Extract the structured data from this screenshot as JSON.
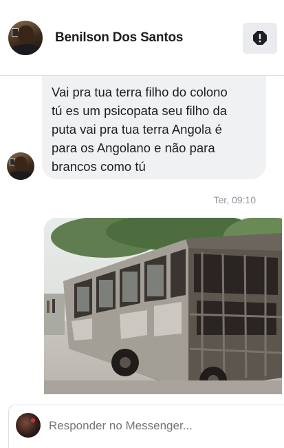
{
  "header": {
    "contact_name": "Benilson Dos Santos",
    "info_icon": "exclamation-octagon-icon"
  },
  "messages": [
    {
      "sender": "Benilson Dos Santos",
      "text": "Vai pra tua terra filho do colono\ntú es um psicopata seu filho da\nputa vai pra tua terra Angola é\npara os Angolano e não para\nbrancos como tú"
    }
  ],
  "timestamp": "Ter, 09:10",
  "attachment": {
    "type": "image",
    "subject": "burned-out bus"
  },
  "composer": {
    "placeholder": "Responder no Messenger..."
  },
  "colors": {
    "bubble": "#eff1f3",
    "header_divider": "#dddfe2",
    "timestamp": "#90949c",
    "placeholder": "#bec3c9"
  }
}
